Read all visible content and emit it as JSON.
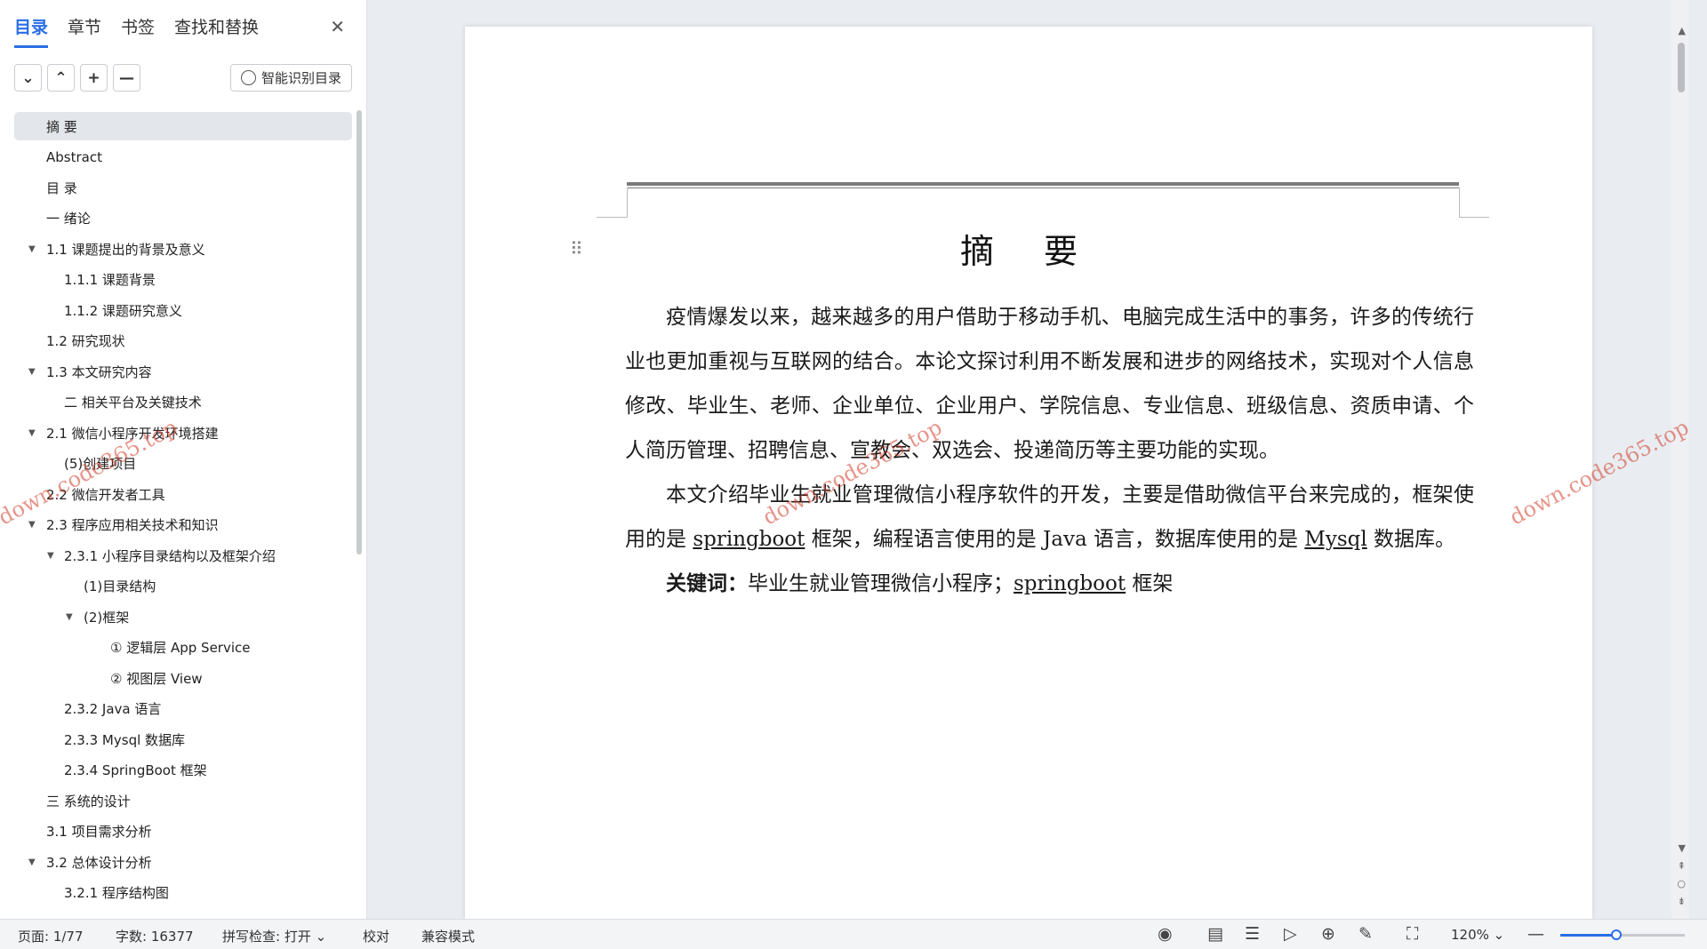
{
  "nav": {
    "tabs": [
      {
        "label": "目录",
        "active": true
      },
      {
        "label": "章节",
        "active": false
      },
      {
        "label": "书签",
        "active": false
      },
      {
        "label": "查找和替换",
        "active": false
      }
    ],
    "close_glyph": "✕",
    "tools": {
      "expand_glyph": "⌄",
      "collapse_glyph": "⌃",
      "add_glyph": "+",
      "remove_glyph": "—",
      "smart_label": "智能识别目录"
    },
    "toc": [
      {
        "label": "摘  要",
        "level": 1,
        "arrow": "",
        "selected": true
      },
      {
        "label": "Abstract",
        "level": 1,
        "arrow": ""
      },
      {
        "label": "目  录",
        "level": 1,
        "arrow": ""
      },
      {
        "label": "一 绪论",
        "level": 1,
        "arrow": ""
      },
      {
        "label": "1.1 课题提出的背景及意义",
        "level": 1,
        "arrow": "▼"
      },
      {
        "label": "1.1.1 课题背景",
        "level": 2,
        "arrow": ""
      },
      {
        "label": "1.1.2 课题研究意义",
        "level": 2,
        "arrow": ""
      },
      {
        "label": "1.2 研究现状",
        "level": 1,
        "arrow": ""
      },
      {
        "label": "1.3 本文研究内容",
        "level": 1,
        "arrow": "▼"
      },
      {
        "label": "二 相关平台及关键技术",
        "level": 2,
        "arrow": ""
      },
      {
        "label": "2.1 微信小程序开发环境搭建",
        "level": 1,
        "arrow": "▼"
      },
      {
        "label": "(5)创建项目",
        "level": 2,
        "arrow": ""
      },
      {
        "label": "2.2 微信开发者工具",
        "level": 1,
        "arrow": ""
      },
      {
        "label": "2.3 程序应用相关技术和知识",
        "level": 1,
        "arrow": "▼"
      },
      {
        "label": "2.3.1 小程序目录结构以及框架介绍",
        "level": 2,
        "arrow": "▼"
      },
      {
        "label": "(1)目录结构",
        "level": 3,
        "arrow": ""
      },
      {
        "label": "(2)框架",
        "level": 3,
        "arrow": "▼"
      },
      {
        "label": "①  逻辑层 App Service",
        "level": 4,
        "arrow": ""
      },
      {
        "label": "②  视图层 View",
        "level": 4,
        "arrow": ""
      },
      {
        "label": "2.3.2 Java 语言",
        "level": 2,
        "arrow": ""
      },
      {
        "label": "2.3.3 Mysql 数据库",
        "level": 2,
        "arrow": ""
      },
      {
        "label": "2.3.4 SpringBoot 框架",
        "level": 2,
        "arrow": ""
      },
      {
        "label": "三 系统的设计",
        "level": 1,
        "arrow": ""
      },
      {
        "label": "3.1 项目需求分析",
        "level": 1,
        "arrow": ""
      },
      {
        "label": "3.2 总体设计分析",
        "level": 1,
        "arrow": "▼"
      },
      {
        "label": "3.2.1 程序结构图",
        "level": 2,
        "arrow": ""
      }
    ]
  },
  "document": {
    "title": "摘 要",
    "para1": "疫情爆发以来，越来越多的用户借助于移动手机、电脑完成生活中的事务，许多的传统行业也更加重视与互联网的结合。本论文探讨利用不断发展和进步的网络技术，实现对个人信息修改、毕业生、老师、企业单位、企业用户、学院信息、专业信息、班级信息、资质申请、个人简历管理、招聘信息、宣教会、双选会、投递简历等主要功能的实现。",
    "para2_a": "本文介绍毕业生就业管理微信小程序软件的开发，主要是借助微信平台来完成的，框架使用的是 ",
    "para2_springboot": "springboot",
    "para2_b": " 框架，编程语言使用的是 Java 语言，数据库使用的是 ",
    "para2_mysql": "Mysql",
    "para2_c": " 数据库。",
    "keywords_label": "关键词：",
    "keywords_a": "毕业生就业管理微信小程序；",
    "keywords_springboot": "springboot",
    "keywords_b": " 框架"
  },
  "watermark": {
    "text": "down.code365.top",
    "color": "#d23c28"
  },
  "status_bar": {
    "page": "页面: 1/77",
    "word_count": "字数: 16377",
    "spell_check": "拼写检查: 打开",
    "spell_arrow": "⌄",
    "proofread": "校对",
    "compat_mode": "兼容模式",
    "zoom": "120%",
    "zoom_arrow": "⌄",
    "zoom_fraction": 0.45
  },
  "colors": {
    "accent": "#2a6ee6",
    "panel_bg": "#ffffff",
    "workspace_bg": "#e9edf1"
  }
}
